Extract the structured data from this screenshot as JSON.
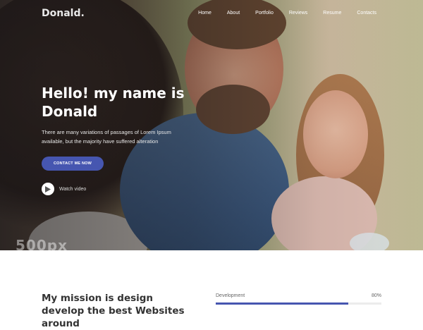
{
  "header": {
    "logo": "Donald.",
    "nav": [
      "Home",
      "About",
      "Portfolio",
      "Reviews",
      "Resume",
      "Contacts"
    ]
  },
  "hero": {
    "title": "Hello! my name is Donald",
    "text": "There are many variations of passages of Lorem Ipsum available, but the majority have suffered alteration",
    "cta_label": "CONTACT ME NOW",
    "watch_label": "Watch video",
    "watermark": "500px"
  },
  "mission": {
    "title": "My mission is design develop the best Websites around"
  },
  "skills": [
    {
      "label": "Development",
      "value_label": "80%",
      "value": 0.8
    }
  ],
  "colors": {
    "accent": "#4656b0",
    "track": "#ececec",
    "heading": "#333333"
  },
  "icons": {
    "play": "play-icon"
  }
}
